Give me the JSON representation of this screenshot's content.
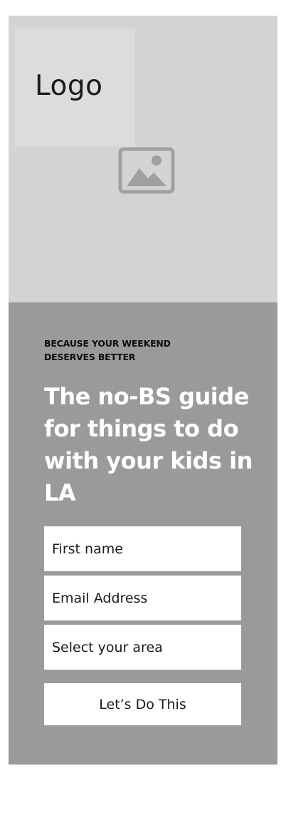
{
  "hero": {
    "logo_text": "Logo",
    "image_icon": "image-placeholder-icon"
  },
  "signup": {
    "eyebrow_line1": "BECAUSE YOUR WEEKEND",
    "eyebrow_line2": "DESERVES BETTER",
    "headline": "The no-BS guide for things to do with your kids in LA",
    "first_name_placeholder": "First name",
    "email_placeholder": "Email Address",
    "area_placeholder": "Select your area",
    "submit_label": "Let’s Do This"
  },
  "colors": {
    "hero_background": "#d3d3d3",
    "logo_box": "#dcdcdc",
    "panel_background": "#9a9a9a",
    "headline_text": "#ffffff",
    "field_background": "#ffffff"
  }
}
